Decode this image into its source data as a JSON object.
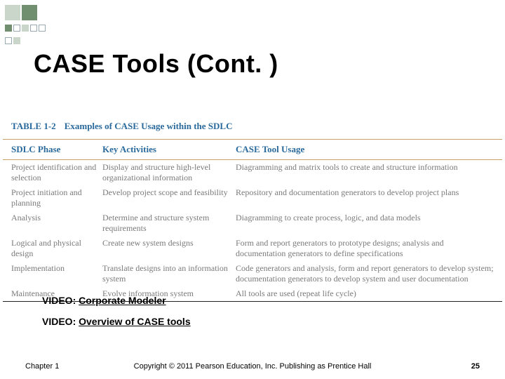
{
  "title": "CASE Tools (Cont. )",
  "table": {
    "number_label": "TABLE 1-2",
    "title": "Examples of CASE Usage within the SDLC",
    "headers": {
      "c1": "SDLC Phase",
      "c2": "Key Activities",
      "c3": "CASE Tool Usage"
    },
    "rows": [
      {
        "c1": "Project identification and selection",
        "c2": "Display and structure high-level organizational information",
        "c3": "Diagramming and matrix tools to create and structure information"
      },
      {
        "c1": "Project initiation and planning",
        "c2": "Develop project scope and feasibility",
        "c3": "Repository and documentation generators to develop project plans"
      },
      {
        "c1": "Analysis",
        "c2": "Determine and structure system requirements",
        "c3": "Diagramming to create process, logic, and data models"
      },
      {
        "c1": "Logical and physical design",
        "c2": "Create new system designs",
        "c3": "Form and report generators to prototype designs; analysis and documentation generators to define specifications"
      },
      {
        "c1": "Implementation",
        "c2": "Translate designs into an information system",
        "c3": "Code generators and analysis, form and report generators to develop system; documentation generators to develop system and user documentation"
      },
      {
        "c1": "Maintenance",
        "c2": "Evolve information system",
        "c3": "All tools are used (repeat life cycle)"
      }
    ]
  },
  "videos": {
    "prefix": "VIDEO: ",
    "link1": "Corporate Modeler",
    "link2": "Overview of CASE tools"
  },
  "footer": {
    "chapter": "Chapter 1",
    "copyright": "Copyright © 2011 Pearson Education, Inc. Publishing as Prentice Hall",
    "page": "25"
  }
}
